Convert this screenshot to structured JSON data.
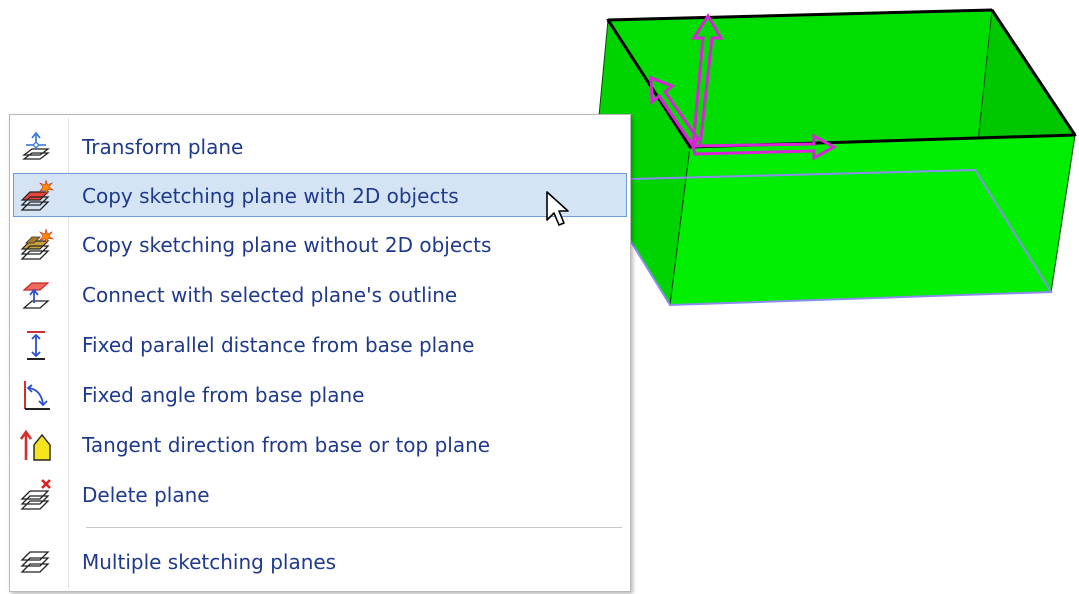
{
  "context_menu": {
    "items": [
      {
        "label": "Transform plane",
        "icon": "transform-plane-icon"
      },
      {
        "label": "Copy sketching plane with 2D objects",
        "icon": "copy-plane-with-objects-icon",
        "highlighted": true
      },
      {
        "label": "Copy sketching plane without 2D objects",
        "icon": "copy-plane-without-objects-icon"
      },
      {
        "label": "Connect with selected plane's outline",
        "icon": "connect-outline-icon"
      },
      {
        "label": "Fixed parallel distance from base plane",
        "icon": "parallel-distance-icon"
      },
      {
        "label": "Fixed angle from base plane",
        "icon": "fixed-angle-icon"
      },
      {
        "label": "Tangent direction from base or top plane",
        "icon": "tangent-direction-icon"
      },
      {
        "label": "Delete plane",
        "icon": "delete-plane-icon"
      },
      {
        "label": "Multiple sketching planes",
        "icon": "multiple-planes-icon"
      }
    ]
  },
  "colors": {
    "box_front": "#00ef00",
    "box_top": "#00dd00",
    "box_side": "#00c800",
    "gizmo": "#d923d9",
    "menu_text": "#1f3a8c",
    "highlight_bg": "#d4e4f5",
    "highlight_border": "#6f9fd6"
  }
}
